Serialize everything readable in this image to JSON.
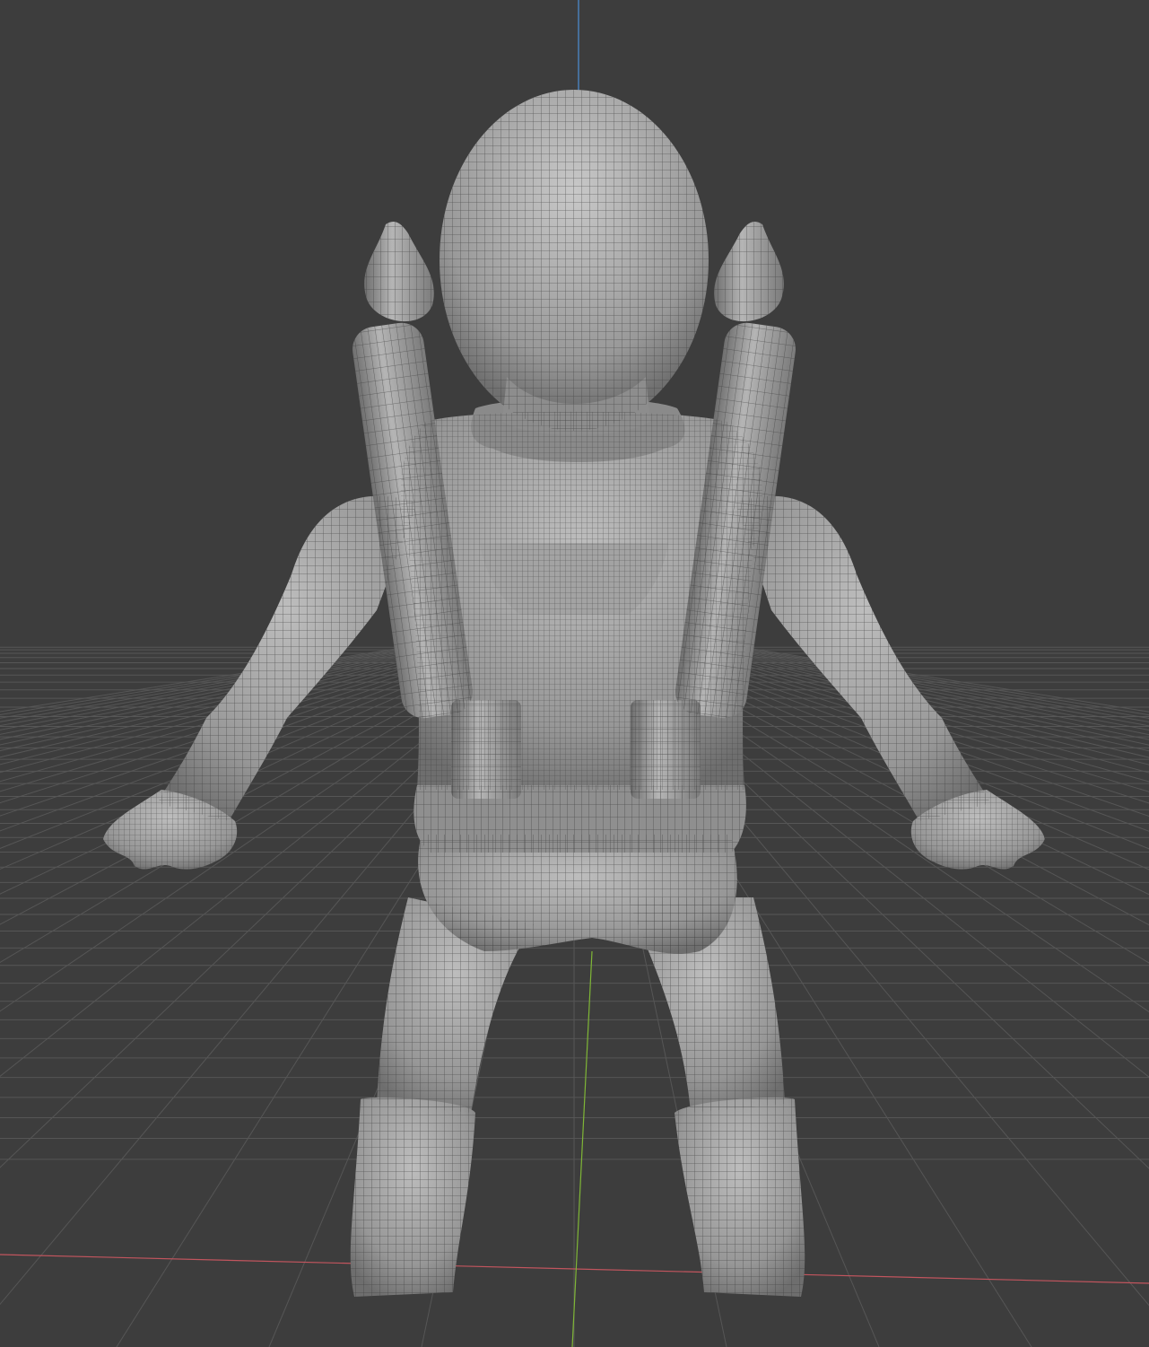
{
  "viewport": {
    "background": "#3d3d3d",
    "grid_color": "#565656",
    "x_axis_color": "#c2555e",
    "y_axis_color": "#7fb636",
    "z_axis_color": "#4d8fd6",
    "mesh_fill": "#9c9c9c",
    "wire_color": "#3a3a3a",
    "model": "wireframe-character-back-view"
  }
}
